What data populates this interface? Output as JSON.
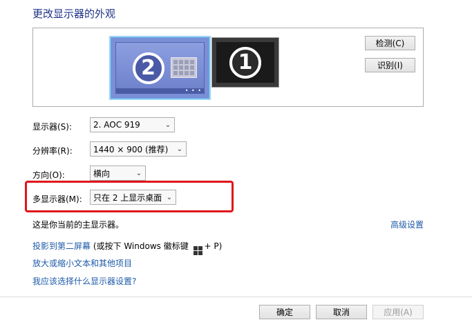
{
  "title": "更改显示器的外观",
  "preview": {
    "monitor_2_number": "2",
    "monitor_1_number": "1",
    "detect_button": "检测(C)",
    "identify_button": "识别(I)"
  },
  "settings": {
    "display_label": "显示器(S):",
    "display_value": "2. AOC 919",
    "resolution_label": "分辨率(R):",
    "resolution_value": "1440 × 900 (推荐)",
    "orientation_label": "方向(O):",
    "orientation_value": "横向",
    "multi_display_label": "多显示器(M):",
    "multi_display_value": "只在 2 上显示桌面"
  },
  "main_display_note": "这是你当前的主显示器。",
  "advanced_link": "高级设置",
  "links": {
    "project_link": "投影到第二屏幕",
    "project_hint_prefix": " (或按下 Windows 徽标键",
    "project_hint_suffix": "+ P)",
    "text_size_link": "放大或缩小文本和其他项目",
    "help_link": "我应该选择什么显示器设置?"
  },
  "footer": {
    "ok": "确定",
    "cancel": "取消",
    "apply": "应用(A)"
  },
  "colors": {
    "title": "#1e3287",
    "link": "#1e5aa8",
    "highlight": "#e0131a"
  }
}
